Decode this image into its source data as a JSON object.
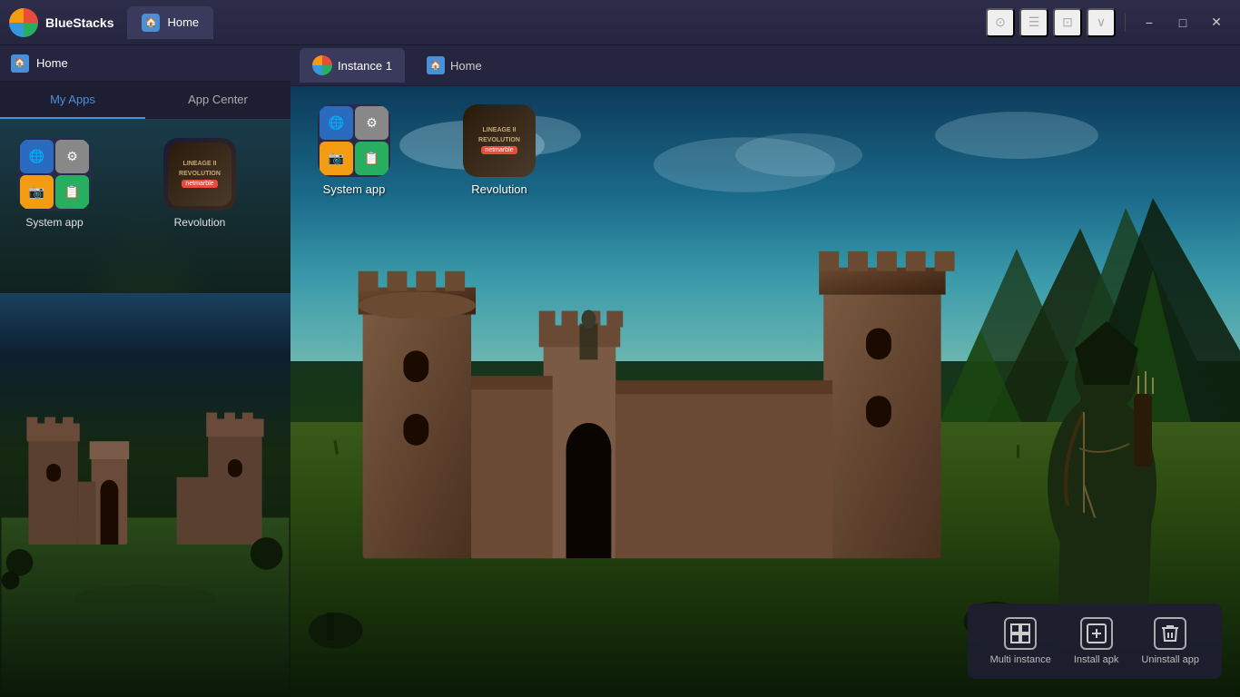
{
  "app": {
    "name": "BlueStacks",
    "logo_colors": [
      "#e74c3c",
      "#27ae60",
      "#3498db",
      "#f39c12"
    ]
  },
  "main_titlebar": {
    "logo_text": "BlueStacks",
    "tab_label": "Home",
    "minimize_label": "−",
    "maximize_label": "□",
    "close_label": "✕",
    "icons": [
      "⊙",
      "☰",
      "⊡",
      "∨"
    ]
  },
  "left_panel": {
    "titlebar": {
      "tab_label": "Home"
    },
    "nav_tabs": [
      {
        "label": "My Apps",
        "active": true
      },
      {
        "label": "App Center",
        "active": false
      }
    ],
    "apps": [
      {
        "label": "System app",
        "type": "grid",
        "sub_icons": [
          "🌐",
          "⚙",
          "📷",
          "📋"
        ]
      },
      {
        "label": "Revolution",
        "type": "lineage",
        "title_line1": "LINEAGE II",
        "title_line2": "REVOLUTION",
        "badge": "netmarble"
      }
    ]
  },
  "instance_window": {
    "tab": {
      "label": "Instance 1"
    },
    "home_tab": {
      "label": "Home"
    },
    "scene_apps": [
      {
        "label": "System app",
        "type": "grid",
        "sub_icons": [
          "🌐",
          "⚙",
          "📷",
          "📋"
        ]
      },
      {
        "label": "Revolution",
        "type": "lineage",
        "title_line1": "LINEAGE II",
        "title_line2": "REVOLUTION",
        "badge": "netmarble"
      }
    ]
  },
  "bottom_toolbar": {
    "buttons": [
      {
        "label": "Multi instance",
        "icon": "⬜"
      },
      {
        "label": "Install apk",
        "icon": "⊕"
      },
      {
        "label": "Uninstall app",
        "icon": "🗑"
      }
    ]
  }
}
